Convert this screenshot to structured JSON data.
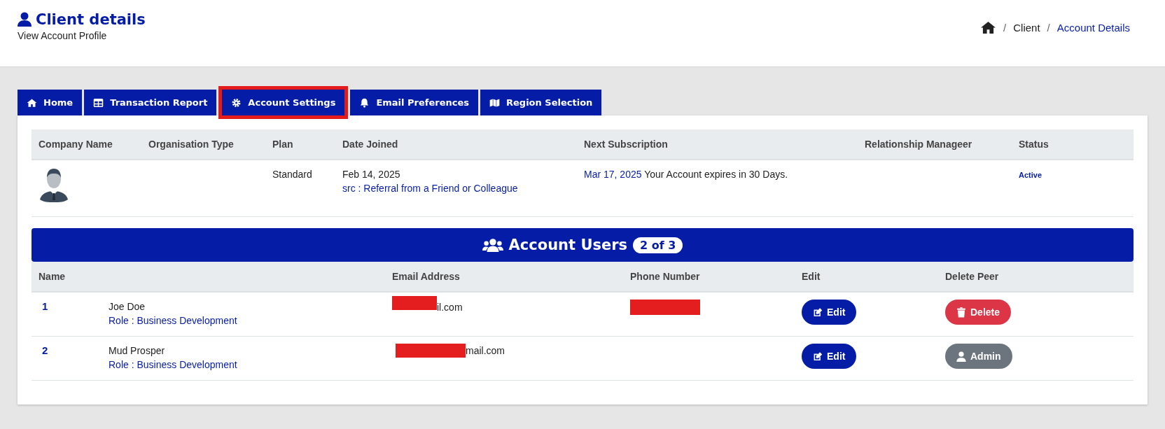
{
  "header": {
    "title": "Client details",
    "subtitle": "View Account Profile"
  },
  "breadcrumb": [
    {
      "separator": "/",
      "label": "Client",
      "current": false
    },
    {
      "separator": "/",
      "label": "Account Details",
      "current": true
    }
  ],
  "tabs": [
    {
      "label": "Home",
      "selected": false
    },
    {
      "label": "Transaction Report",
      "selected": false
    },
    {
      "label": "Account Settings",
      "selected": true
    },
    {
      "label": "Email Preferences",
      "selected": false
    },
    {
      "label": "Region Selection",
      "selected": false
    }
  ],
  "account_table": {
    "columns": [
      "Company Name",
      "Organisation Type",
      "Plan",
      "Date Joined",
      "Next Subscription",
      "Relationship Manageer",
      "Status"
    ],
    "row": {
      "plan": "Standard",
      "date_joined": "Feb 14, 2025",
      "source": "src : Referral from a Friend or Colleague",
      "next_date": "Mar 17, 2025",
      "next_note": "Your Account expires in 30 Days.",
      "status": "Active"
    }
  },
  "users": {
    "title": "Account Users",
    "count": "2 of 3",
    "columns": [
      "Name",
      "Email Address",
      "Phone Number",
      "Edit",
      "Delete Peer"
    ],
    "rows": [
      {
        "index": "1",
        "name": "Joe Doe",
        "role": "Role : Business Development",
        "email": "il.com",
        "phone_redacted": true,
        "edit": "Edit",
        "action": {
          "kind": "delete",
          "label": "Delete"
        }
      },
      {
        "index": "2",
        "name": "Mud Prosper",
        "role": "Role : Business Development",
        "email": "mail.com",
        "phone_redacted": false,
        "edit": "Edit",
        "action": {
          "kind": "admin",
          "label": "Admin"
        }
      }
    ]
  }
}
